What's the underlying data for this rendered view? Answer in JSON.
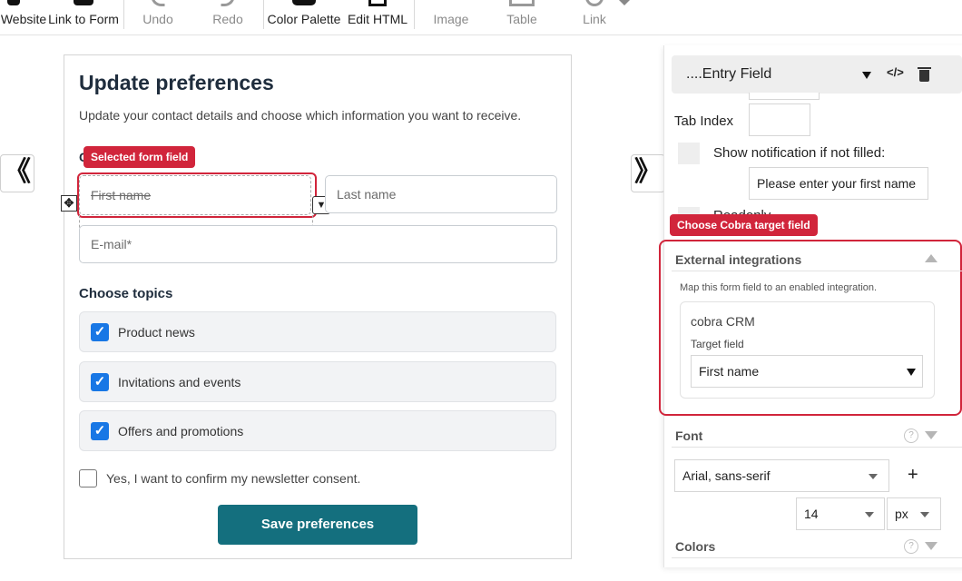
{
  "toolbar": {
    "items": [
      {
        "label": "Website",
        "icon": "globe-icon"
      },
      {
        "label": "Link to Form",
        "icon": "link-form-icon"
      },
      {
        "label": "Undo",
        "icon": "undo-icon"
      },
      {
        "label": "Redo",
        "icon": "redo-icon"
      },
      {
        "label": "Color Palette",
        "icon": "palette-icon"
      },
      {
        "label": "Edit HTML",
        "icon": "html-icon"
      },
      {
        "label": "Image",
        "icon": "image-icon"
      },
      {
        "label": "Table",
        "icon": "table-icon"
      },
      {
        "label": "Link",
        "icon": "link-icon"
      }
    ]
  },
  "nav": {
    "left_toggle": "《",
    "right_toggle": "》"
  },
  "form": {
    "title": "Update preferences",
    "subtitle": "Update your contact details and choose which information you want to receive.",
    "section_label_partial": "C",
    "selected_badge": "Selected form field",
    "first_name_placeholder": "First name",
    "last_name_placeholder": "Last name",
    "email_placeholder": "E-mail*",
    "topics_title": "Choose topics",
    "topics": [
      {
        "label": "Product news",
        "checked": true
      },
      {
        "label": "Invitations and events",
        "checked": true
      },
      {
        "label": "Offers and promotions",
        "checked": true
      }
    ],
    "consent_label": "Yes, I want to confirm my newsletter consent.",
    "save_label": "Save preferences"
  },
  "panel": {
    "header_title": "....Entry Field",
    "tab_index_label": "Tab Index",
    "show_notification_label": "Show notification if not filled:",
    "notification_value": "Please enter your first name",
    "readonly_partial": "Readonly",
    "cobra_badge": "Choose Cobra target field",
    "external": {
      "title": "External integrations",
      "description": "Map this form field to an enabled integration.",
      "integration_name": "cobra CRM",
      "target_label": "Target field",
      "target_value": "First name"
    },
    "font": {
      "title": "Font",
      "family": "Arial, sans-serif",
      "size": "14",
      "unit": "px",
      "add": "+"
    },
    "colors_title": "Colors",
    "help": "?"
  },
  "colors": {
    "accent_red": "#d1253b",
    "save_button": "#146f7e",
    "checkbox": "#1877e5"
  }
}
